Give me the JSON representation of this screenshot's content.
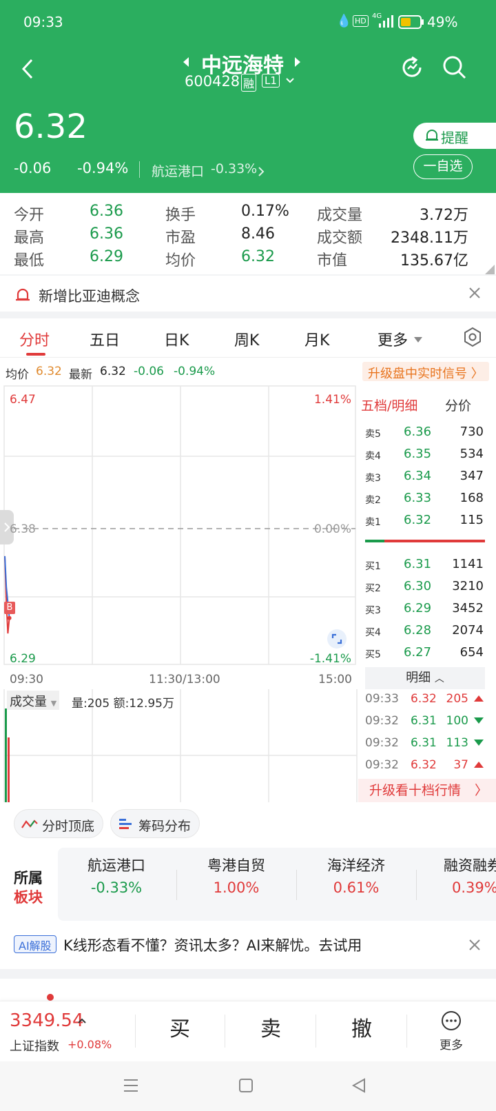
{
  "status": {
    "time": "09:33",
    "battery": "49%",
    "network": "4G",
    "hd": "HD"
  },
  "header": {
    "stock_name": "中远海特",
    "stock_code": "600428",
    "badge_rong": "融",
    "badge_level": "L1",
    "price": "6.32",
    "change": "-0.06",
    "change_pct": "-0.94%",
    "sector_name": "航运港口",
    "sector_pct": "-0.33%",
    "alert_label": "提醒",
    "watchlist_label": "一自选"
  },
  "quote": {
    "open_label": "今开",
    "open": "6.36",
    "high_label": "最高",
    "high": "6.36",
    "low_label": "最低",
    "low": "6.29",
    "turnover_label": "换手",
    "turnover": "0.17%",
    "pe_label": "市盈",
    "pe": "8.46",
    "avg_label": "均价",
    "avg": "6.32",
    "vol_label": "成交量",
    "vol": "3.72万",
    "amount_label": "成交额",
    "amount": "2348.11万",
    "mcap_label": "市值",
    "mcap": "135.67亿"
  },
  "notice": {
    "text": "新增比亚迪概念"
  },
  "tabs": [
    "分时",
    "五日",
    "日K",
    "周K",
    "月K",
    "更多"
  ],
  "chart_info": {
    "avg_label": "均价",
    "avg": "6.32",
    "latest_label": "最新",
    "latest": "6.32",
    "change": "-0.06",
    "change_pct": "-0.94%",
    "upgrade": "升级盘中实时信号 〉"
  },
  "chart_data": {
    "type": "line",
    "y_top": "6.47",
    "y_mid": "6.38",
    "y_bottom": "6.29",
    "pct_top": "1.41%",
    "pct_mid": "0.00%",
    "pct_bottom": "-1.41%",
    "ylim": [
      6.29,
      6.47
    ],
    "x_start": "09:30",
    "x_mid": "11:30/13:00",
    "x_end": "15:00",
    "buy_marker": "B",
    "series": [
      {
        "values": [
          6.36,
          6.33,
          6.31,
          6.32
        ]
      },
      {
        "values": [
          6.36,
          6.34,
          6.33,
          6.32
        ]
      }
    ],
    "volume": {
      "label": "成交量",
      "info": "量:205 额:12.95万"
    }
  },
  "orderbook": {
    "tab1": "五档/明细",
    "tab2": "分价",
    "asks": [
      {
        "label": "卖5",
        "price": "6.36",
        "vol": "730"
      },
      {
        "label": "卖4",
        "price": "6.35",
        "vol": "534"
      },
      {
        "label": "卖3",
        "price": "6.34",
        "vol": "347"
      },
      {
        "label": "卖2",
        "price": "6.33",
        "vol": "168"
      },
      {
        "label": "卖1",
        "price": "6.32",
        "vol": "115"
      }
    ],
    "bids": [
      {
        "label": "买1",
        "price": "6.31",
        "vol": "1141"
      },
      {
        "label": "买2",
        "price": "6.30",
        "vol": "3210"
      },
      {
        "label": "买3",
        "price": "6.29",
        "vol": "3452"
      },
      {
        "label": "买4",
        "price": "6.28",
        "vol": "2074"
      },
      {
        "label": "买5",
        "price": "6.27",
        "vol": "654"
      }
    ],
    "detail_label": "明细",
    "details": [
      {
        "time": "09:33",
        "price": "6.32",
        "vol": "205",
        "dir": "up"
      },
      {
        "time": "09:32",
        "price": "6.31",
        "vol": "100",
        "dir": "down"
      },
      {
        "time": "09:32",
        "price": "6.31",
        "vol": "113",
        "dir": "down"
      },
      {
        "time": "09:32",
        "price": "6.32",
        "vol": "37",
        "dir": "up"
      }
    ],
    "upgrade_ten": "升级看十档行情"
  },
  "tools": {
    "top_bottom": "分时顶底",
    "chips": "筹码分布"
  },
  "sectors": {
    "title_line1": "所属",
    "title_line2": "板块",
    "items": [
      {
        "name": "航运港口",
        "pct": "-0.33%"
      },
      {
        "name": "粤港自贸",
        "pct": "1.00%"
      },
      {
        "name": "海洋经济",
        "pct": "0.61%"
      },
      {
        "name": "融资融券",
        "pct": "0.39%"
      }
    ]
  },
  "ai": {
    "badge": "AI解股",
    "text": "K线形态看不懂？资讯太多？AI来解忧。去试用"
  },
  "bottom": {
    "index_value": "3349.54",
    "index_name": "上证指数",
    "index_pct": "+0.08%",
    "buy": "买",
    "sell": "卖",
    "cancel": "撤",
    "more": "更多"
  },
  "colors": {
    "header_green": "#2bae5f",
    "up_red": "#e03a3a",
    "down_green": "#1a9a4b",
    "avg_orange": "#e08a2e"
  }
}
